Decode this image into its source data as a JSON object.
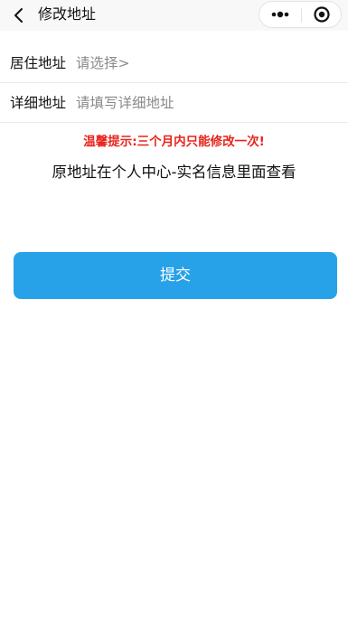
{
  "navbar": {
    "title": "修改地址",
    "back_icon": "chevron-left-icon",
    "more_icon": "more-dots-icon",
    "close_icon": "target-circle-icon"
  },
  "form": {
    "residence_label": "居住地址",
    "residence_value": "请选择>",
    "detail_label": "详细地址",
    "detail_placeholder": "请填写详细地址"
  },
  "notice": {
    "warning": "温馨提示:三个月内只能修改一次!",
    "info": "原地址在个人中心-实名信息里面查看"
  },
  "actions": {
    "submit_label": "提交"
  },
  "colors": {
    "accent": "#27a2e8",
    "warning": "#e8231a",
    "navbar_bg": "#f8f8f8"
  }
}
